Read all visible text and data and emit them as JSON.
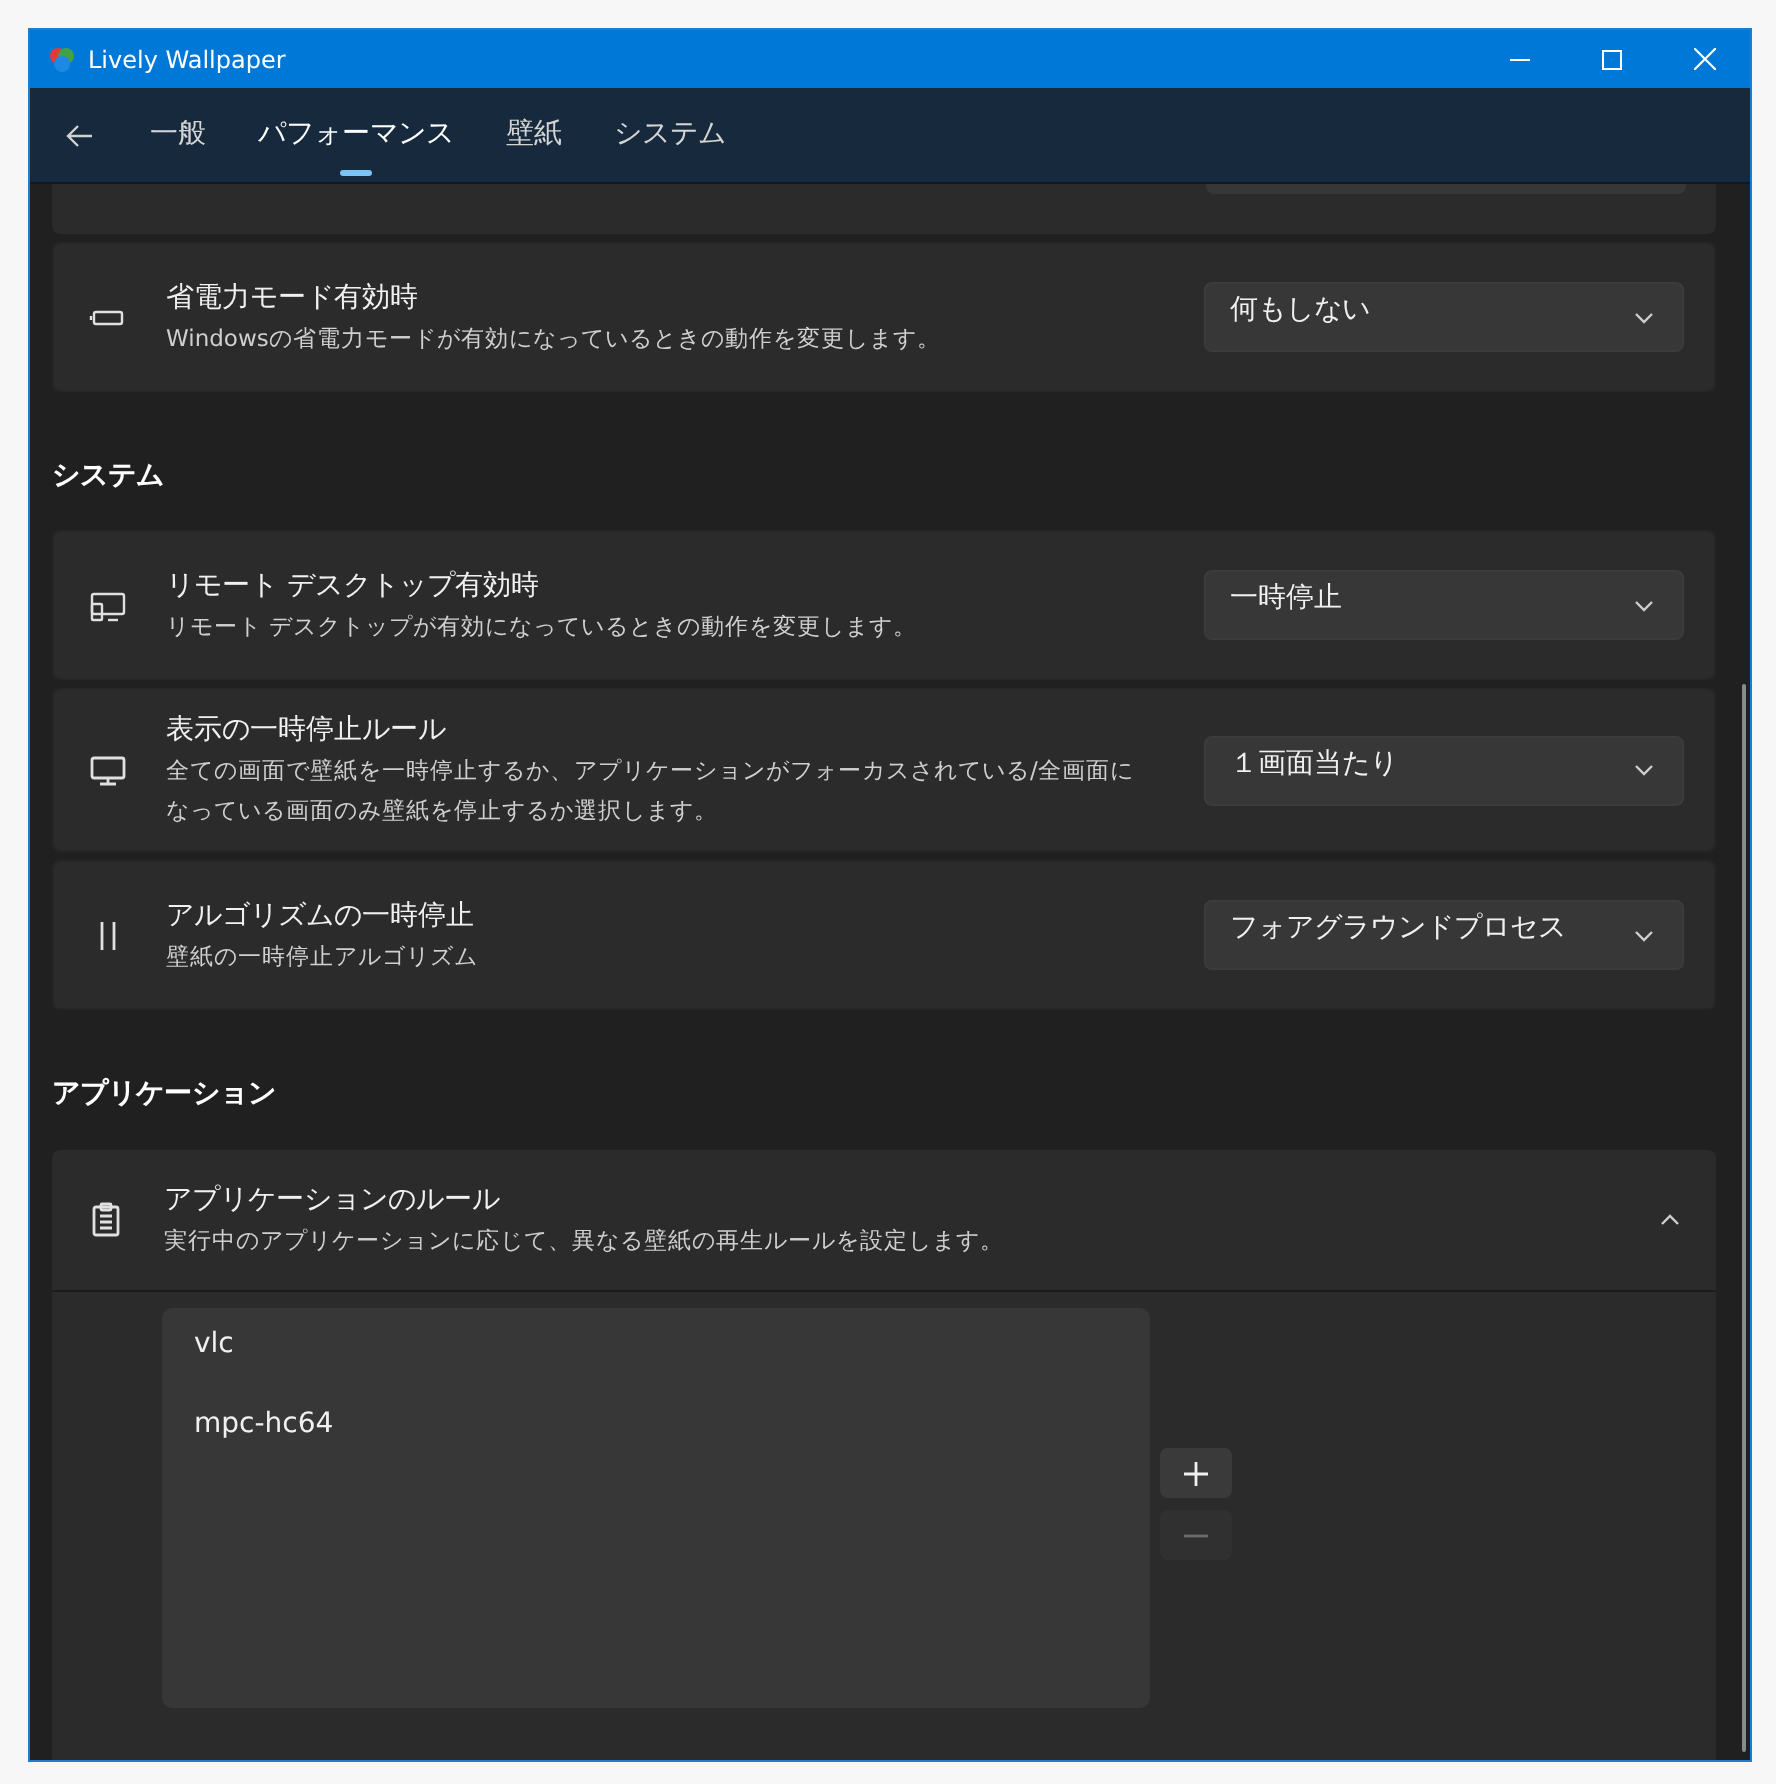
{
  "window": {
    "title": "Lively Wallpaper"
  },
  "tabs": [
    {
      "label": "一般",
      "selected": false
    },
    {
      "label": "パフォーマンス",
      "selected": true
    },
    {
      "label": "壁紙",
      "selected": false
    },
    {
      "label": "システム",
      "selected": false
    }
  ],
  "top_cards": [
    {
      "kind": "battery",
      "title": "省電力モード有効時",
      "description": "Windowsの省電力モードが有効になっているときの動作を変更します。",
      "value": "何もしない"
    }
  ],
  "sections": [
    {
      "title": "システム",
      "cards": [
        {
          "kind": "remote",
          "title": "リモート デスクトップ有効時",
          "description": "リモート デスクトップが有効になっているときの動作を変更します。",
          "value": "一時停止"
        },
        {
          "kind": "monitor",
          "title": "表示の一時停止ルール",
          "description": "全ての画面で壁紙を一時停止するか、アプリケーションがフォーカスされている/全画面になっている画面のみ壁紙を停止するか選択します。",
          "value": "１画面当たり"
        },
        {
          "kind": "pause",
          "title": "アルゴリズムの一時停止",
          "description": "壁紙の一時停止アルゴリズム",
          "value": "フォアグラウンドプロセス"
        }
      ]
    }
  ],
  "applications": {
    "title": "アプリケーション",
    "expander": {
      "title": "アプリケーションのルール",
      "description": "実行中のアプリケーションに応じて、異なる壁紙の再生ルールを設定します。",
      "expanded": true,
      "items": [
        {
          "label": "vlc",
          "selected": false
        },
        {
          "label": "mpc-hc64",
          "selected": false
        }
      ],
      "buttons": [
        {
          "kind": "add",
          "disabled": false
        },
        {
          "kind": "remove",
          "disabled": true
        }
      ]
    }
  }
}
